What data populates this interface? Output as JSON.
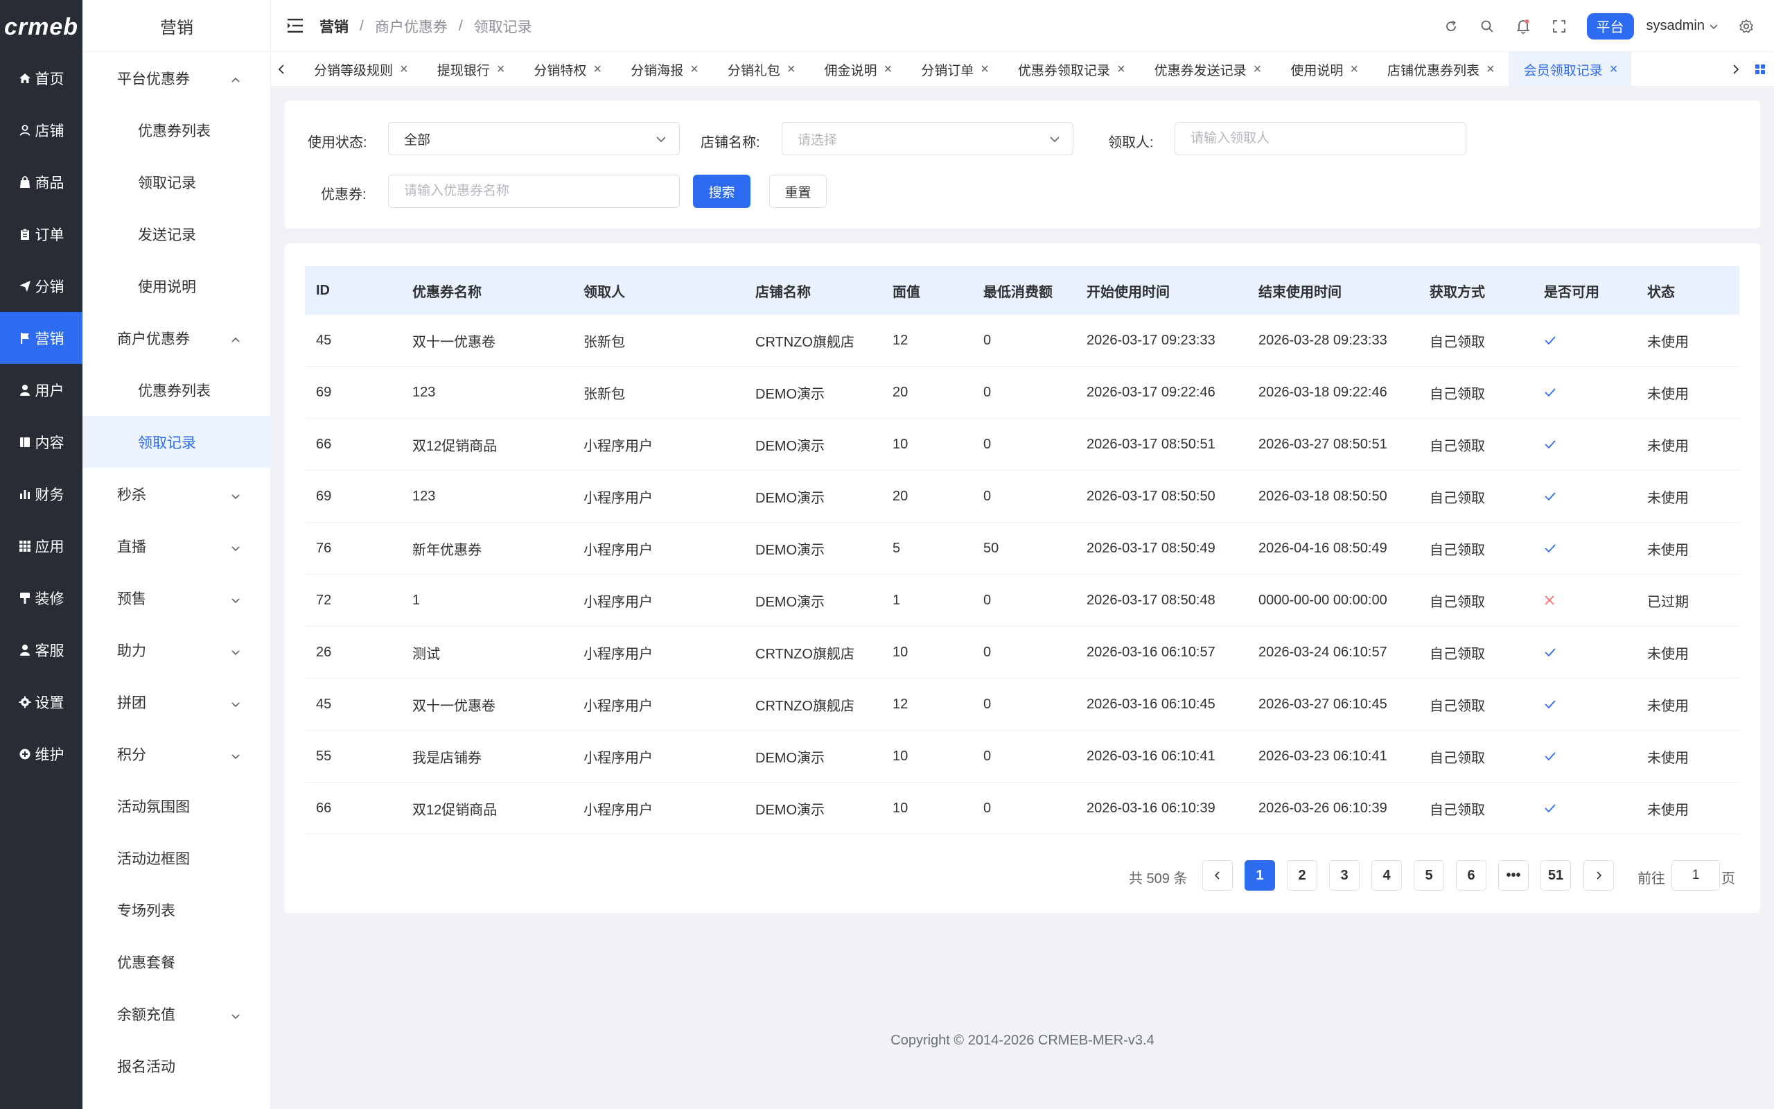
{
  "logo": {
    "text": "crmeb"
  },
  "rail": [
    {
      "label": "首页",
      "icon": "home-icon",
      "active": false
    },
    {
      "label": "店铺",
      "icon": "shop-icon",
      "active": false
    },
    {
      "label": "商品",
      "icon": "bag-icon",
      "active": false
    },
    {
      "label": "订单",
      "icon": "clipboard-icon",
      "active": false
    },
    {
      "label": "分销",
      "icon": "send-icon",
      "active": false
    },
    {
      "label": "营销",
      "icon": "flag-icon",
      "active": true
    },
    {
      "label": "用户",
      "icon": "user-icon",
      "active": false
    },
    {
      "label": "内容",
      "icon": "book-icon",
      "active": false
    },
    {
      "label": "财务",
      "icon": "chart-icon",
      "active": false
    },
    {
      "label": "应用",
      "icon": "grid-icon",
      "active": false
    },
    {
      "label": "装修",
      "icon": "brush-icon",
      "active": false
    },
    {
      "label": "客服",
      "icon": "headset-icon",
      "active": false
    },
    {
      "label": "设置",
      "icon": "gear-icon",
      "active": false
    },
    {
      "label": "维护",
      "icon": "wrench-icon",
      "active": false
    }
  ],
  "sub": {
    "title": "营销",
    "items": [
      {
        "label": "平台优惠券",
        "level": 1,
        "chevron": "up",
        "active": false
      },
      {
        "label": "优惠券列表",
        "level": 2,
        "chevron": "",
        "active": false
      },
      {
        "label": "领取记录",
        "level": 2,
        "chevron": "",
        "active": false
      },
      {
        "label": "发送记录",
        "level": 2,
        "chevron": "",
        "active": false
      },
      {
        "label": "使用说明",
        "level": 2,
        "chevron": "",
        "active": false
      },
      {
        "label": "商户优惠券",
        "level": 1,
        "chevron": "up",
        "active": false
      },
      {
        "label": "优惠券列表",
        "level": 2,
        "chevron": "",
        "active": false
      },
      {
        "label": "领取记录",
        "level": 2,
        "chevron": "",
        "active": true
      },
      {
        "label": "秒杀",
        "level": 1,
        "chevron": "down",
        "active": false
      },
      {
        "label": "直播",
        "level": 1,
        "chevron": "down",
        "active": false
      },
      {
        "label": "预售",
        "level": 1,
        "chevron": "down",
        "active": false
      },
      {
        "label": "助力",
        "level": 1,
        "chevron": "down",
        "active": false
      },
      {
        "label": "拼团",
        "level": 1,
        "chevron": "down",
        "active": false
      },
      {
        "label": "积分",
        "level": 1,
        "chevron": "down",
        "active": false
      },
      {
        "label": "活动氛围图",
        "level": 1,
        "chevron": "",
        "active": false
      },
      {
        "label": "活动边框图",
        "level": 1,
        "chevron": "",
        "active": false
      },
      {
        "label": "专场列表",
        "level": 1,
        "chevron": "",
        "active": false
      },
      {
        "label": "优惠套餐",
        "level": 1,
        "chevron": "",
        "active": false
      },
      {
        "label": "余额充值",
        "level": 1,
        "chevron": "down",
        "active": false
      },
      {
        "label": "报名活动",
        "level": 1,
        "chevron": "",
        "active": false
      }
    ]
  },
  "header": {
    "crumb_root": "营销",
    "crumb_mid": "商户优惠券",
    "crumb_cur": "领取记录",
    "separator": "/",
    "platform_badge": "平台",
    "username": "sysadmin"
  },
  "tabs": [
    {
      "label": "分销等级规则",
      "active": false
    },
    {
      "label": "提现银行",
      "active": false
    },
    {
      "label": "分销特权",
      "active": false
    },
    {
      "label": "分销海报",
      "active": false
    },
    {
      "label": "分销礼包",
      "active": false
    },
    {
      "label": "佣金说明",
      "active": false
    },
    {
      "label": "分销订单",
      "active": false
    },
    {
      "label": "优惠券领取记录",
      "active": false
    },
    {
      "label": "优惠券发送记录",
      "active": false
    },
    {
      "label": "使用说明",
      "active": false
    },
    {
      "label": "店铺优惠券列表",
      "active": false
    },
    {
      "label": "会员领取记录",
      "active": true
    }
  ],
  "filter": {
    "status_label": "使用状态:",
    "status_value": "全部",
    "shop_label": "店铺名称:",
    "shop_placeholder": "请选择",
    "receiver_label": "领取人:",
    "receiver_placeholder": "请输入领取人",
    "coupon_label": "优惠券:",
    "coupon_placeholder": "请输入优惠券名称",
    "search_btn": "搜索",
    "reset_btn": "重置"
  },
  "table": {
    "columns": [
      "ID",
      "优惠券名称",
      "领取人",
      "店铺名称",
      "面值",
      "最低消费额",
      "开始使用时间",
      "结束使用时间",
      "获取方式",
      "是否可用",
      "状态"
    ],
    "rows": [
      {
        "id": "45",
        "name": "双十一优惠卷",
        "receiver": "张新包",
        "shop": "CRTNZO旗舰店",
        "value": "12",
        "min": "0",
        "start": "2026-03-17 09:23:33",
        "end": "2026-03-28 09:23:33",
        "method": "自己领取",
        "usable": true,
        "status": "未使用"
      },
      {
        "id": "69",
        "name": "123",
        "receiver": "张新包",
        "shop": "DEMO演示",
        "value": "20",
        "min": "0",
        "start": "2026-03-17 09:22:46",
        "end": "2026-03-18 09:22:46",
        "method": "自己领取",
        "usable": true,
        "status": "未使用"
      },
      {
        "id": "66",
        "name": "双12促销商品",
        "receiver": "小程序用户",
        "shop": "DEMO演示",
        "value": "10",
        "min": "0",
        "start": "2026-03-17 08:50:51",
        "end": "2026-03-27 08:50:51",
        "method": "自己领取",
        "usable": true,
        "status": "未使用"
      },
      {
        "id": "69",
        "name": "123",
        "receiver": "小程序用户",
        "shop": "DEMO演示",
        "value": "20",
        "min": "0",
        "start": "2026-03-17 08:50:50",
        "end": "2026-03-18 08:50:50",
        "method": "自己领取",
        "usable": true,
        "status": "未使用"
      },
      {
        "id": "76",
        "name": "新年优惠券",
        "receiver": "小程序用户",
        "shop": "DEMO演示",
        "value": "5",
        "min": "50",
        "start": "2026-03-17 08:50:49",
        "end": "2026-04-16 08:50:49",
        "method": "自己领取",
        "usable": true,
        "status": "未使用"
      },
      {
        "id": "72",
        "name": "1",
        "receiver": "小程序用户",
        "shop": "DEMO演示",
        "value": "1",
        "min": "0",
        "start": "2026-03-17 08:50:48",
        "end": "0000-00-00 00:00:00",
        "method": "自己领取",
        "usable": false,
        "status": "已过期"
      },
      {
        "id": "26",
        "name": "测试",
        "receiver": "小程序用户",
        "shop": "CRTNZO旗舰店",
        "value": "10",
        "min": "0",
        "start": "2026-03-16 06:10:57",
        "end": "2026-03-24 06:10:57",
        "method": "自己领取",
        "usable": true,
        "status": "未使用"
      },
      {
        "id": "45",
        "name": "双十一优惠卷",
        "receiver": "小程序用户",
        "shop": "CRTNZO旗舰店",
        "value": "12",
        "min": "0",
        "start": "2026-03-16 06:10:45",
        "end": "2026-03-27 06:10:45",
        "method": "自己领取",
        "usable": true,
        "status": "未使用"
      },
      {
        "id": "55",
        "name": "我是店铺券",
        "receiver": "小程序用户",
        "shop": "DEMO演示",
        "value": "10",
        "min": "0",
        "start": "2026-03-16 06:10:41",
        "end": "2026-03-23 06:10:41",
        "method": "自己领取",
        "usable": true,
        "status": "未使用"
      },
      {
        "id": "66",
        "name": "双12促销商品",
        "receiver": "小程序用户",
        "shop": "DEMO演示",
        "value": "10",
        "min": "0",
        "start": "2026-03-16 06:10:39",
        "end": "2026-03-26 06:10:39",
        "method": "自己领取",
        "usable": true,
        "status": "未使用"
      }
    ]
  },
  "pagination": {
    "total_text": "共 509 条",
    "pages": [
      "1",
      "2",
      "3",
      "4",
      "5",
      "6",
      "•••",
      "51"
    ],
    "current": "1",
    "goto_label": "前往",
    "goto_value": "1",
    "page_suffix": "页"
  },
  "footer": {
    "copyright": "Copyright © 2014-2026 CRMEB-MER-v3.4"
  },
  "colors": {
    "primary": "#2d6cf0",
    "rail_bg": "#282c34",
    "check": "#2d6cf0",
    "cross": "#f56c6c"
  }
}
